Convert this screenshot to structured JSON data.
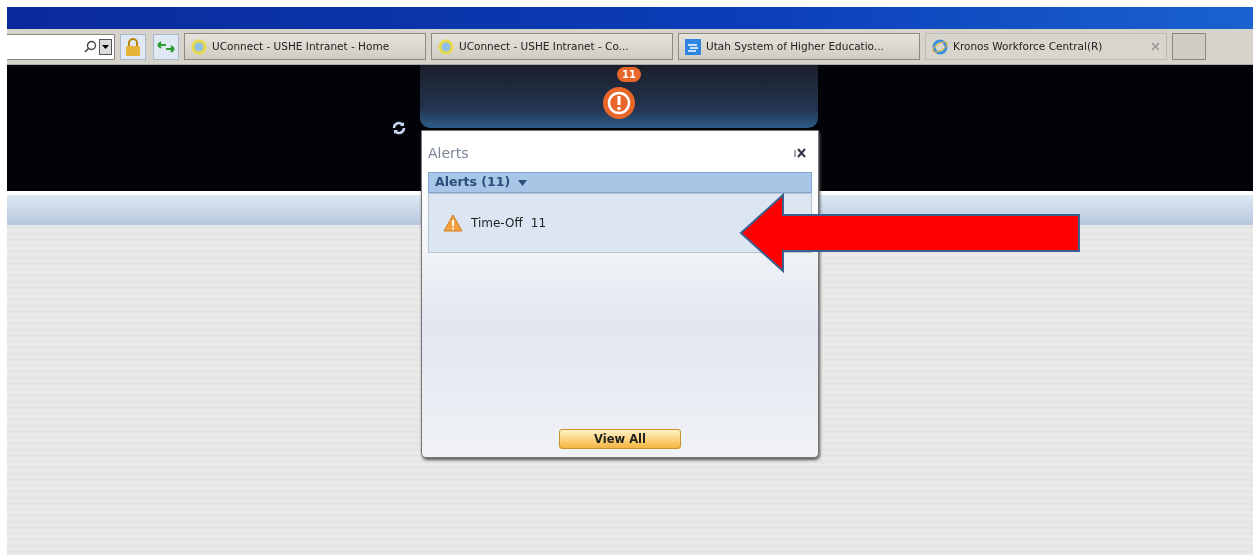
{
  "browser": {
    "tabs": [
      {
        "title": "UConnect - USHE Intranet - Home",
        "kind": "globe",
        "selected": false
      },
      {
        "title": "UConnect - USHE Intranet - Co...",
        "kind": "globe",
        "selected": false
      },
      {
        "title": "Utah System of Higher Educatio...",
        "kind": "site",
        "selected": false
      },
      {
        "title": "Kronos Workforce Central(R)",
        "kind": "ie",
        "selected": true
      }
    ]
  },
  "header": {
    "alert_badge": "11"
  },
  "alerts_panel": {
    "title": "Alerts",
    "filter": "Alerts (11)",
    "items": [
      {
        "label": "Time-Off",
        "count": "11"
      }
    ],
    "button": "View All"
  }
}
